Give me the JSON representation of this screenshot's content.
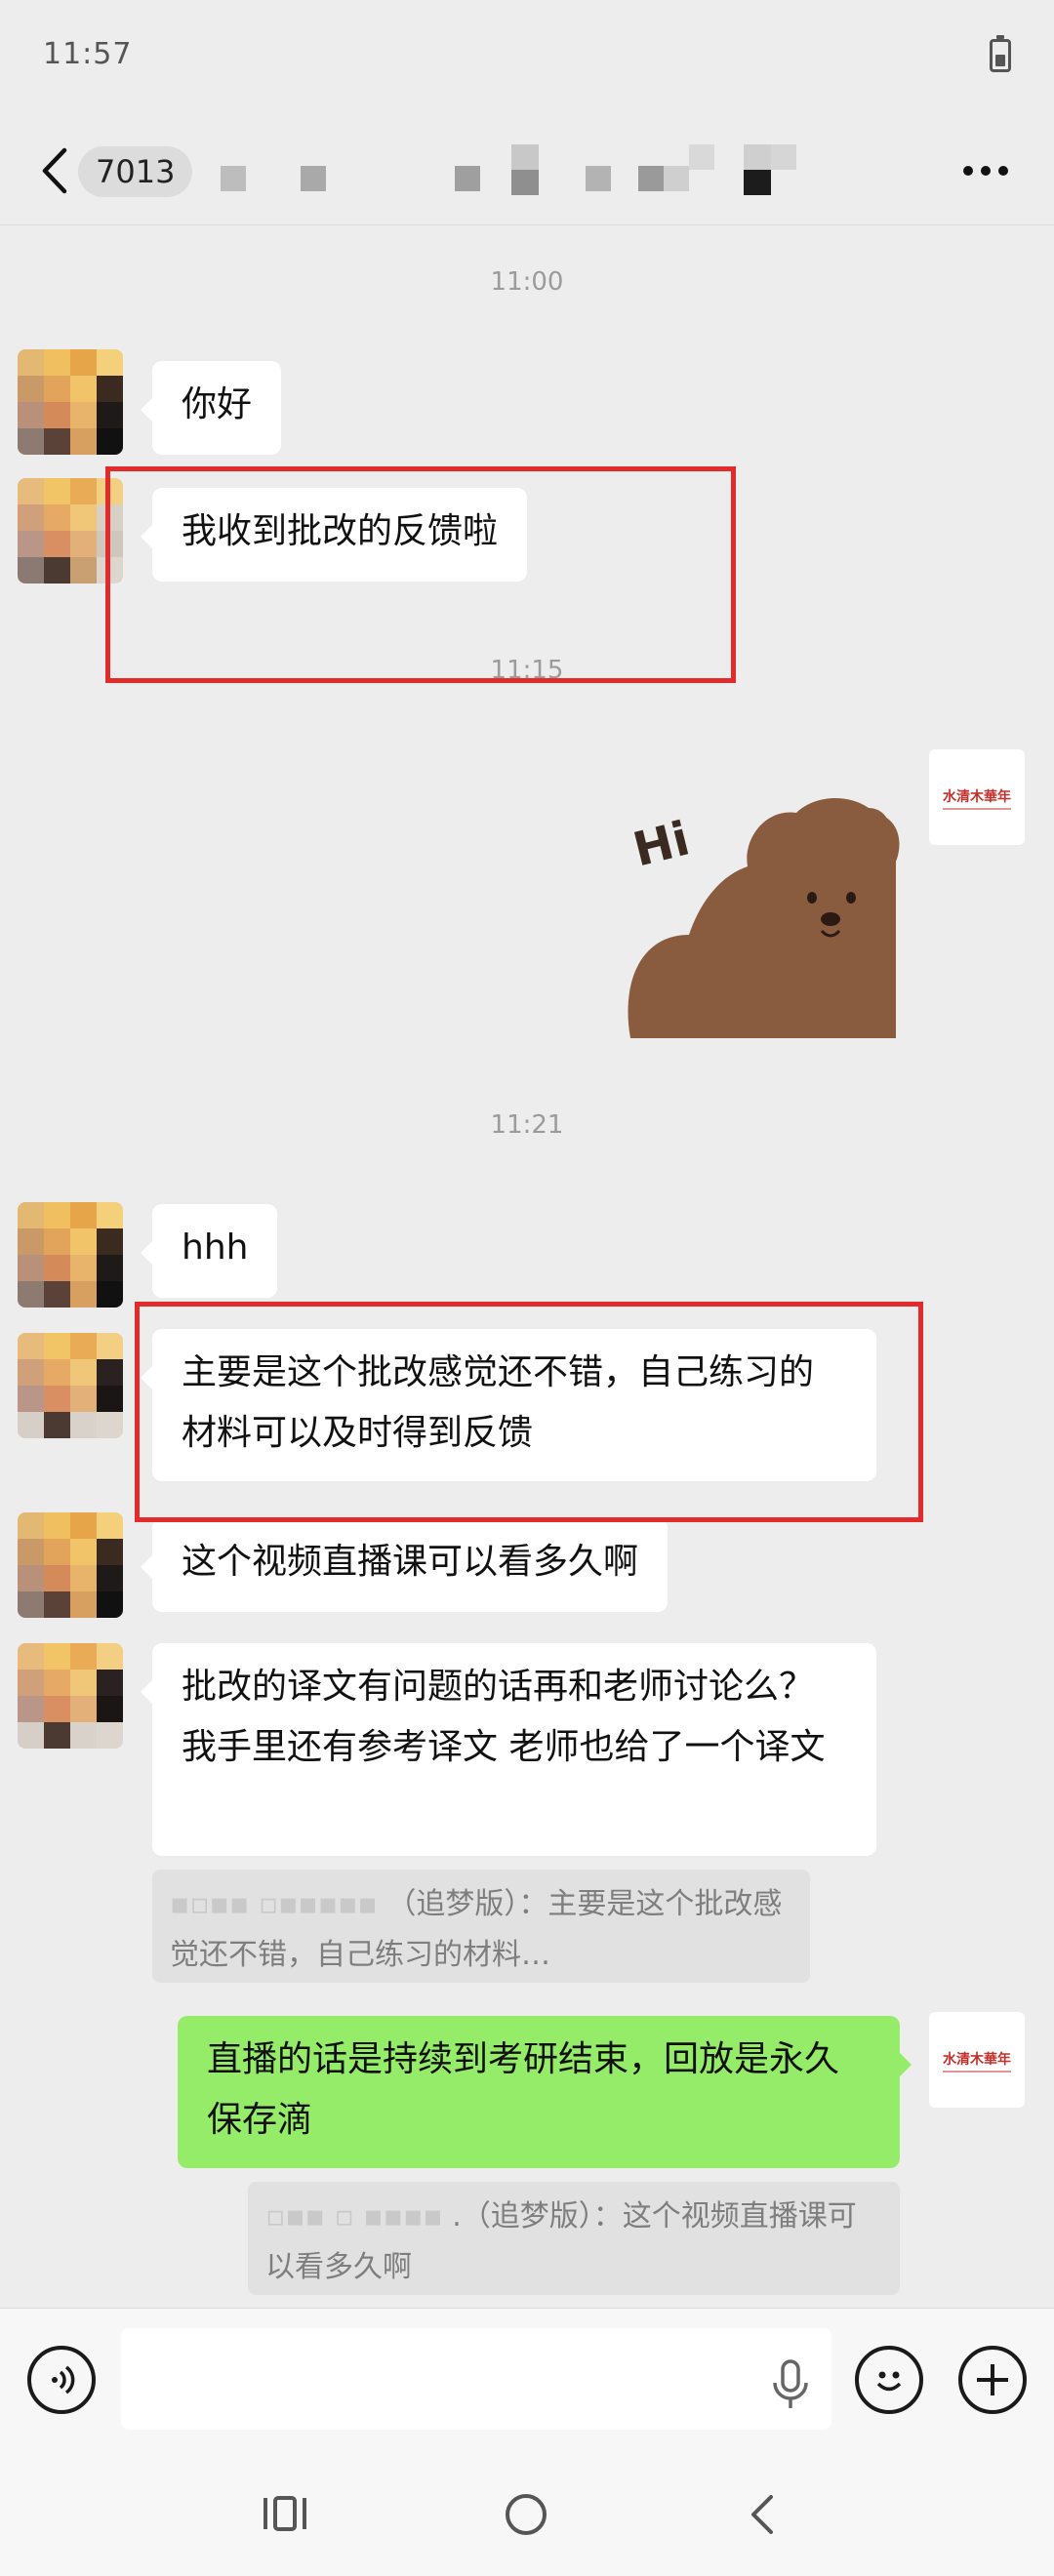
{
  "status_bar": {
    "time": "11:57",
    "battery_icon": "battery-icon"
  },
  "header": {
    "back_icon": "chevron-left-icon",
    "unread_count": "7013",
    "more_icon": "more-dots-icon"
  },
  "timestamps": [
    "11:00",
    "11:15",
    "11:21"
  ],
  "messages": [
    {
      "side": "left",
      "text": "你好"
    },
    {
      "side": "left",
      "text": "我收到批改的反馈啦"
    },
    {
      "side": "right",
      "type": "sticker",
      "sticker_text": "Hi"
    },
    {
      "side": "left",
      "text": "hhh"
    },
    {
      "side": "left",
      "text": "主要是这个批改感觉还不错，自己练习的材料可以及时得到反馈"
    },
    {
      "side": "left",
      "text": "这个视频直播课可以看多久啊"
    },
    {
      "side": "left",
      "text": "批改的译文有问题的话再和老师讨论么？ 我手里还有参考译文 老师也给了一个译文"
    },
    {
      "side": "right",
      "text": "直播的话是持续到考研结束，回放是永久保存滴"
    }
  ],
  "quotes": [
    {
      "text": "（追梦版）：主要是这个批改感觉还不错，自己练习的材料…"
    },
    {
      "text": ".（追梦版）：这个视频直播课可以看多久啊"
    }
  ],
  "self_avatar_text": "水清木華年",
  "input_bar": {
    "voice_icon": "voice-icon",
    "mic_icon": "microphone-icon",
    "emoji_icon": "emoji-icon",
    "plus_icon": "plus-icon"
  },
  "nav": {
    "recent_icon": "recent-apps-icon",
    "home_icon": "home-icon",
    "back_icon": "nav-back-icon"
  },
  "colors": {
    "background": "#ededed",
    "green_bubble": "#95ec69",
    "highlight": "#e32b2b"
  }
}
